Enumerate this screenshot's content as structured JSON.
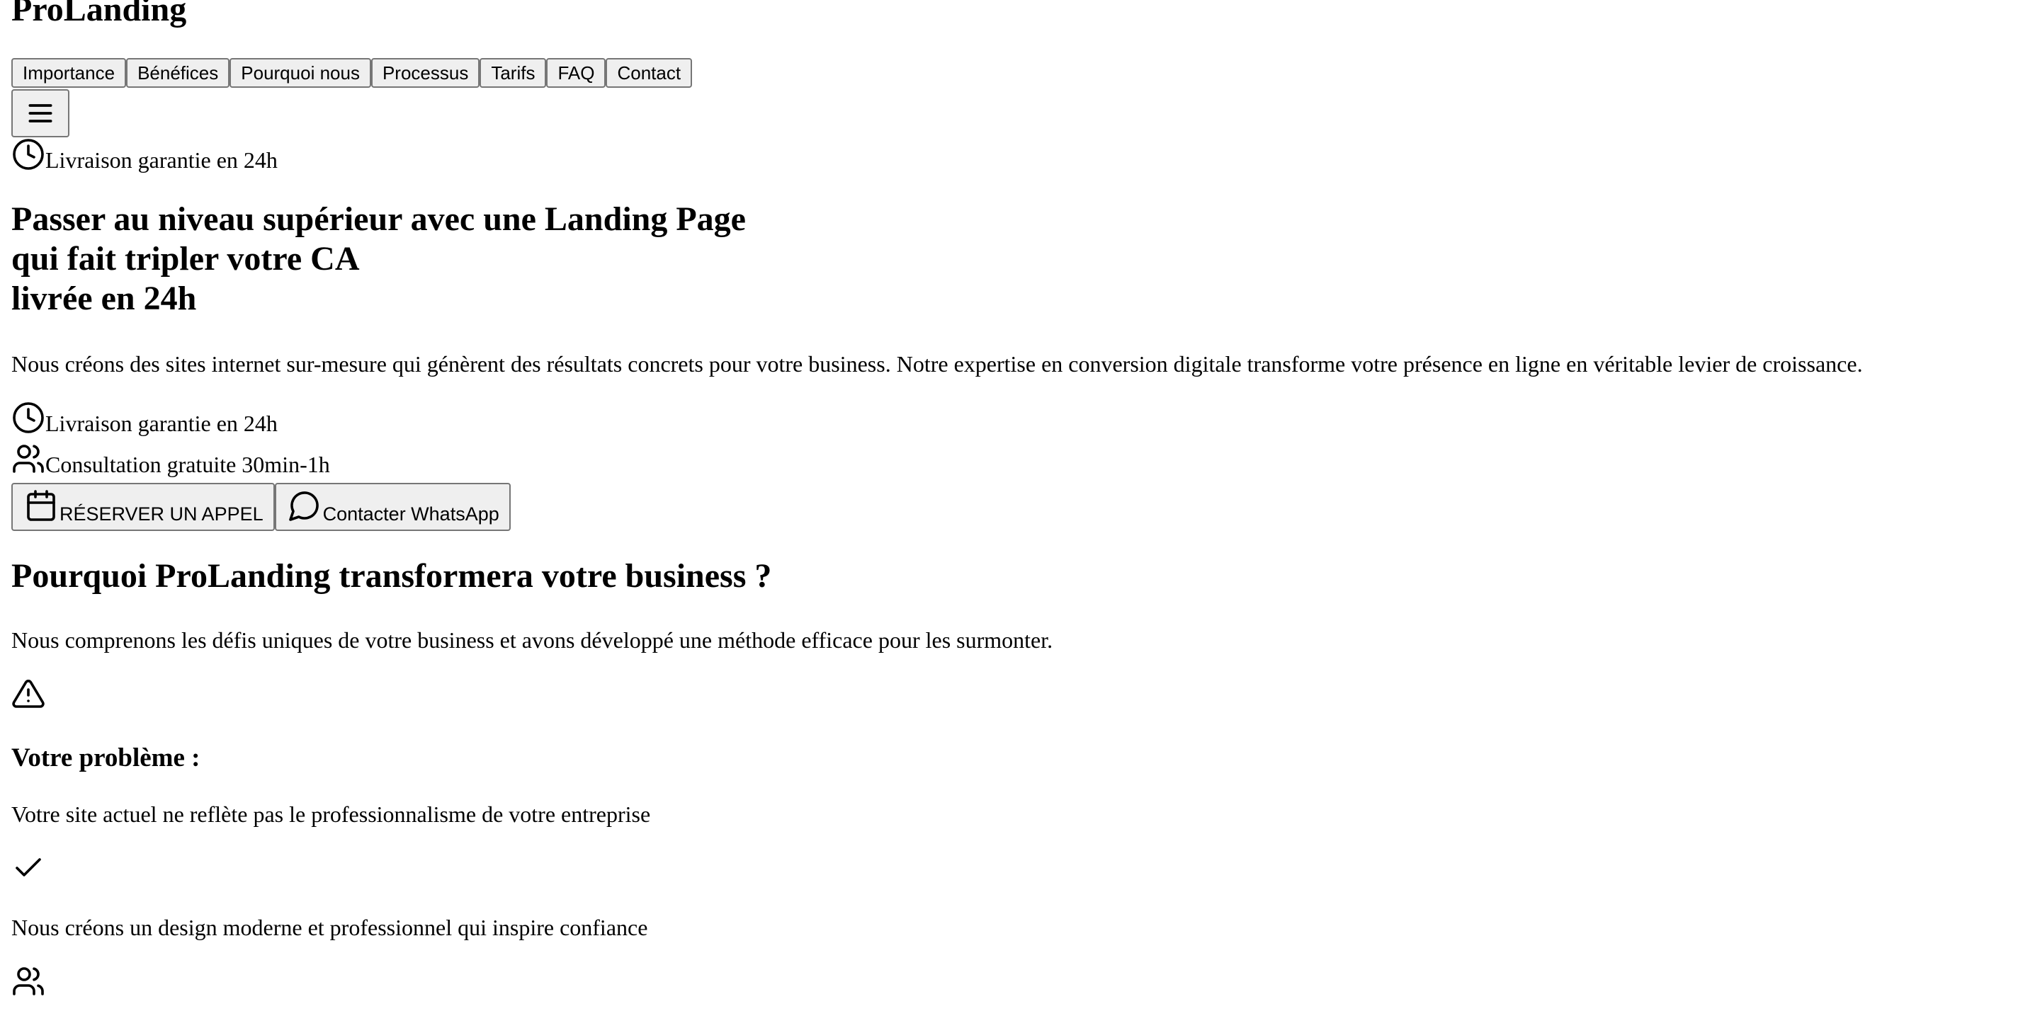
{
  "header": {
    "brand": "ProLanding",
    "nav": [
      "Importance",
      "Bénéfices",
      "Pourquoi nous",
      "Processus",
      "Tarifs",
      "FAQ",
      "Contact"
    ],
    "menu_icon": "hamburger-menu-icon"
  },
  "hero": {
    "badge": {
      "icon": "clock-icon",
      "text": "Livraison garantie en 24h"
    },
    "title_lines": [
      "Passer au niveau supérieur avec une Landing Page",
      "qui fait tripler votre CA",
      "livrée en 24h"
    ],
    "description": "Nous créons des sites internet sur-mesure qui génèrent des résultats concrets pour votre business. Notre expertise en conversion digitale transforme votre présence en ligne en véritable levier de croissance.",
    "features": [
      {
        "icon": "clock-icon",
        "text": "Livraison garantie en 24h"
      },
      {
        "icon": "users-icon",
        "text": "Consultation gratuite 30min-1h"
      }
    ],
    "cta_primary": {
      "icon": "calendar-icon",
      "label": "RÉSERVER UN APPEL"
    },
    "cta_secondary": {
      "icon": "message-circle-icon",
      "label": "Contacter WhatsApp"
    }
  },
  "why": {
    "title": "Pourquoi ProLanding transformera votre business ?",
    "subtitle": "Nous comprenons les défis uniques de votre business et avons développé une méthode efficace pour les surmonter.",
    "card": {
      "problem_icon": "warning-triangle-icon",
      "problem_title": "Votre problème :",
      "problem_text": "Votre site actuel ne reflète pas le professionnalisme de votre entreprise",
      "solution_icon": "check-icon",
      "solution_text": "Nous créons un design moderne et professionnel qui inspire confiance"
    },
    "next_icon": "users-icon"
  }
}
